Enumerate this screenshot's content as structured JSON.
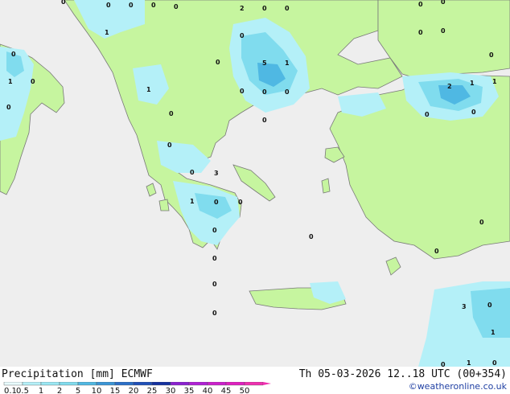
{
  "map": {
    "colors": {
      "sea": "#eeeeee",
      "land": "#c6f59f",
      "coast": "#787878",
      "precip_light": "#b4f0f8",
      "precip_mid": "#80dcee",
      "precip_high": "#4fb8e3",
      "precip_core": "#3a95d6"
    },
    "cell_values": [
      {
        "id": "al-north",
        "text": "1"
      },
      {
        "id": "it-west",
        "text": "1"
      },
      {
        "id": "it-1",
        "text": "0"
      },
      {
        "id": "it-2",
        "text": "0"
      },
      {
        "id": "it-3",
        "text": "0"
      },
      {
        "id": "mk-1",
        "text": "1"
      },
      {
        "id": "gr-n1",
        "text": "0"
      },
      {
        "id": "gr-n2",
        "text": "0"
      },
      {
        "id": "bg-1",
        "text": "0"
      },
      {
        "id": "bg-5",
        "text": "5"
      },
      {
        "id": "bg-1b",
        "text": "1"
      },
      {
        "id": "gr-ne1",
        "text": "0"
      },
      {
        "id": "gr-ne2",
        "text": "0"
      },
      {
        "id": "gr-ne3",
        "text": "0"
      },
      {
        "id": "tr-2",
        "text": "2"
      },
      {
        "id": "tr-1",
        "text": "1"
      },
      {
        "id": "tr-1b",
        "text": "1"
      },
      {
        "id": "tr-0",
        "text": "0"
      },
      {
        "id": "tr-0b",
        "text": "0"
      },
      {
        "id": "ro-2",
        "text": "2"
      },
      {
        "id": "ro-0a",
        "text": "0"
      },
      {
        "id": "ro-0b",
        "text": "0"
      },
      {
        "id": "top-0a",
        "text": "0"
      },
      {
        "id": "top-0b",
        "text": "0"
      },
      {
        "id": "top-0c",
        "text": "0"
      },
      {
        "id": "top-0d",
        "text": "0"
      },
      {
        "id": "top-0e",
        "text": "0"
      },
      {
        "id": "top-0f",
        "text": "0"
      },
      {
        "id": "bs-0a",
        "text": "0"
      },
      {
        "id": "bs-0b",
        "text": "0"
      },
      {
        "id": "bs-0c",
        "text": "0"
      },
      {
        "id": "gr-c1",
        "text": "0"
      },
      {
        "id": "gr-c2",
        "text": "0"
      },
      {
        "id": "gr-c3",
        "text": "0"
      },
      {
        "id": "gr-pel3",
        "text": "3"
      },
      {
        "id": "gr-pel0",
        "text": "0"
      },
      {
        "id": "gr-pel1",
        "text": "1"
      },
      {
        "id": "gr-pel0b",
        "text": "0"
      },
      {
        "id": "gr-s0",
        "text": "0"
      },
      {
        "id": "gr-s0b",
        "text": "0"
      },
      {
        "id": "gr-s0c",
        "text": "0"
      },
      {
        "id": "gr-a0",
        "text": "0"
      },
      {
        "id": "gr-w0",
        "text": "0"
      },
      {
        "id": "tr-s0",
        "text": "0"
      },
      {
        "id": "tr-s0b",
        "text": "0"
      },
      {
        "id": "cy-0",
        "text": "0"
      },
      {
        "id": "cy-3",
        "text": "3"
      },
      {
        "id": "cy-0b",
        "text": "0"
      },
      {
        "id": "sea-1",
        "text": "1"
      },
      {
        "id": "sea-1b",
        "text": "1"
      },
      {
        "id": "sea-0",
        "text": "0"
      },
      {
        "id": "cr-0",
        "text": "0"
      }
    ]
  },
  "footer": {
    "title": "Precipitation [mm] ECMWF",
    "datetime": "Th 05-03-2026 12..18 UTC (00+354)",
    "credit": "©weatheronline.co.uk"
  },
  "legend": {
    "ticks": [
      "0.1",
      "0.5",
      "1",
      "2",
      "5",
      "10",
      "15",
      "20",
      "25",
      "30",
      "35",
      "40",
      "45",
      "50"
    ],
    "colors": [
      "#e8fbfd",
      "#b4f0f8",
      "#9ae8f4",
      "#80dcee",
      "#4fb8e3",
      "#3a95d6",
      "#2a6fc8",
      "#1f4fb8",
      "#13309f",
      "#8a1fd0",
      "#b01fd6",
      "#cc1fcc",
      "#e01fc0",
      "#f02fb0"
    ]
  }
}
